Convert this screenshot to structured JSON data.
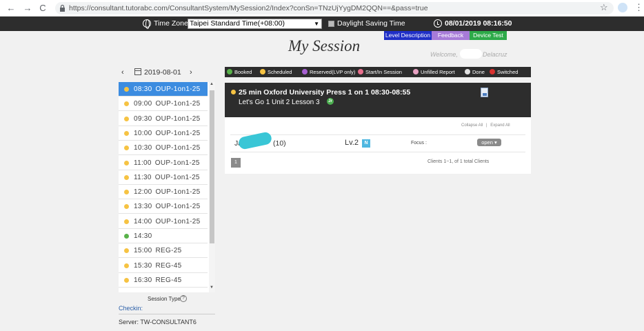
{
  "browser": {
    "back": "←",
    "forward": "→",
    "reload": "C",
    "url": "https://consultant.tutorabc.com/ConsultantSystem/MySession2/Index?conSn=TNzUjYygDM2QQN==&pass=true",
    "star": "☆",
    "menu": "⋮"
  },
  "topbar": {
    "timezone_label": "Time Zone:",
    "timezone_value": "Taipei Standard Time(+08:00)",
    "dst_label": "Daylight Saving Time",
    "datetime": "08/01/2019 08:16:50"
  },
  "header": {
    "title": "My Session",
    "level_description": "Level Description",
    "feedback": "Feedback",
    "device_test": "Device Test",
    "welcome": "Welcome,",
    "user_name": "Delacruz"
  },
  "date_nav": {
    "prev": "‹",
    "date": "2019-08-01",
    "next": "›"
  },
  "legend": [
    {
      "label": "Booked",
      "color": "#59b24a"
    },
    {
      "label": "Scheduled",
      "color": "#f6c343"
    },
    {
      "label": "Reserved(LVP only)",
      "color": "#a65fd1"
    },
    {
      "label": "Start/In Session",
      "color": "#e86f8d"
    },
    {
      "label": "Unfilled Report",
      "color": "#e7a1c2"
    },
    {
      "label": "Done",
      "color": "#e0e0e0"
    },
    {
      "label": "Switched",
      "color": "#d9312f"
    }
  ],
  "sessions": [
    {
      "time": "08:30",
      "name": "OUP-1on1-25",
      "color": "#f6c343",
      "active": true
    },
    {
      "time": "09:00",
      "name": "OUP-1on1-25",
      "color": "#f6c343"
    },
    {
      "time": "09:30",
      "name": "OUP-1on1-25",
      "color": "#f6c343"
    },
    {
      "time": "10:00",
      "name": "OUP-1on1-25",
      "color": "#f6c343"
    },
    {
      "time": "10:30",
      "name": "OUP-1on1-25",
      "color": "#f6c343"
    },
    {
      "time": "11:00",
      "name": "OUP-1on1-25",
      "color": "#f6c343"
    },
    {
      "time": "11:30",
      "name": "OUP-1on1-25",
      "color": "#f6c343"
    },
    {
      "time": "12:00",
      "name": "OUP-1on1-25",
      "color": "#f6c343"
    },
    {
      "time": "13:30",
      "name": "OUP-1on1-25",
      "color": "#f6c343"
    },
    {
      "time": "14:00",
      "name": "OUP-1on1-25",
      "color": "#f6c343"
    },
    {
      "time": "14:30",
      "name": "",
      "color": "#59b24a"
    },
    {
      "time": "15:00",
      "name": "REG-25",
      "color": "#f6c343"
    },
    {
      "time": "15:30",
      "name": "REG-45",
      "color": "#f6c343"
    },
    {
      "time": "16:30",
      "name": "REG-45",
      "color": "#f6c343"
    }
  ],
  "sidebar_footer": {
    "session_type": "Session Type",
    "help": "?",
    "checkin": "Checkin:",
    "server": "Server: TW-CONSULTANT6"
  },
  "session_detail": {
    "title": "25 min Oxford University Press 1 on 1 08:30-08:55",
    "subtitle": "Let's Go 1 Unit 2 Lesson 3",
    "jr_badge": "Jr",
    "collapse_all": "Collapse All",
    "expand_all": "Expand All",
    "separator": "|",
    "client_name_prefix": "Ja",
    "client_age": "(10)",
    "level": "Lv.2",
    "level_badge": "N",
    "focus_label": "Focus :",
    "open_button": "open ▾",
    "page_button": "1",
    "clients_info": "Clients 1~1, of 1 total Clients"
  }
}
